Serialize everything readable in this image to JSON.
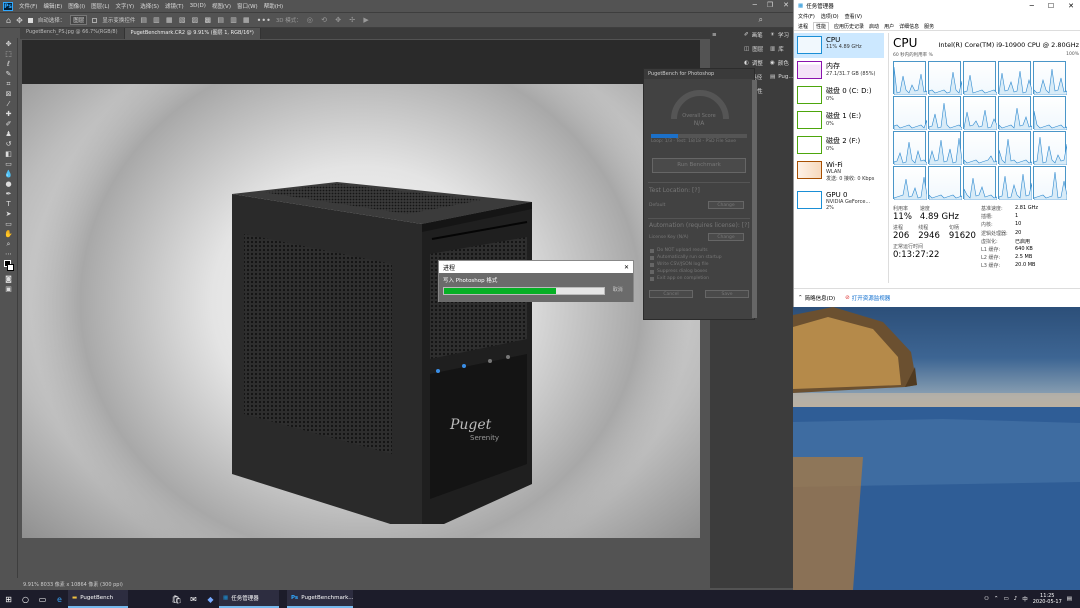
{
  "ps": {
    "logo": "Ps",
    "menu": [
      "文件(F)",
      "编辑(E)",
      "图像(I)",
      "图层(L)",
      "文字(Y)",
      "选择(S)",
      "滤镜(T)",
      "3D(D)",
      "视图(V)",
      "窗口(W)",
      "帮助(H)"
    ],
    "options": {
      "auto_select": "自动选择：",
      "layer_dropdown": "图层",
      "show_transform": "显示变换控件",
      "mode_label": "3D 模式："
    },
    "tabs": [
      "PugetBench_PS.jpg @ 66.7%(RGB/8)",
      "PugetBenchmark.CR2 @ 9.91% (图层 1, RGB/16*)"
    ],
    "status": "9.91%   8033 像素 x 10864 像素 (300 ppi)",
    "right_panels": [
      "画笔",
      "图层",
      "调整",
      "路径",
      "属性",
      "学习",
      "库",
      "颜色"
    ],
    "right_top": [
      "Pug..."
    ]
  },
  "puget": {
    "header": "PugetBench for Photoshop",
    "overall_label": "Overall Score",
    "overall_value": "N/A",
    "progress_text": "Loop: 1/3 · Test: 18/18 - PSD File Save",
    "run_button": "Run Benchmark",
    "test_location_title": "Test Location: [?]",
    "test_location_value": "Default",
    "change_label": "Change",
    "automation_title": "Automation (requires license): [?]",
    "license_key": "License Key (N/A)",
    "checkboxes": [
      "Do NOT upload results",
      "Automatically run on startup",
      "Write CSV/JSON log file",
      "Suppress dialog boxes",
      "Exit app on completion"
    ],
    "cancel": "Cancel",
    "save": "Save"
  },
  "dialog": {
    "title": "进程",
    "message": "写入 Photoshop 格式",
    "cancel": "取消",
    "progress": 0.7
  },
  "tm": {
    "title": "任务管理器",
    "menus": [
      "文件(F)",
      "选项(O)",
      "查看(V)"
    ],
    "tabs": [
      "进程",
      "性能",
      "应用历史记录",
      "启动",
      "用户",
      "详细信息",
      "服务"
    ],
    "resources": [
      {
        "name": "CPU",
        "val": "11% 4.89 GHz",
        "color": "#1a8fd6"
      },
      {
        "name": "内存",
        "val": "27.1/31.7 GB (85%)",
        "color": "#8b12ae"
      },
      {
        "name": "磁盘 0 (C: D:)",
        "val": "0%",
        "color": "#4da60c"
      },
      {
        "name": "磁盘 1 (E:)",
        "val": "0%",
        "color": "#4da60c"
      },
      {
        "name": "磁盘 2 (F:)",
        "val": "0%",
        "color": "#4da60c"
      },
      {
        "name": "Wi-Fi",
        "val": "WLAN",
        "val2": "发送: 0 接收: 0 Kbps",
        "color": "#a74f01"
      },
      {
        "name": "GPU 0",
        "val": "NVIDIA GeForce...",
        "val2": "2%",
        "color": "#1a8fd6"
      }
    ],
    "cpu_title": "CPU",
    "cpu_model": "Intel(R) Core(TM) i9-10900 CPU @ 2.80GHz",
    "chart_left": "60 秒内的利用率 %",
    "chart_right": "100%",
    "util_lbl": "利用率",
    "util_val": "11%",
    "speed_lbl": "速度",
    "speed_val": "4.89 GHz",
    "proc_lbl": "进程",
    "proc_val": "206",
    "thread_lbl": "线程",
    "thread_val": "2946",
    "handle_lbl": "句柄",
    "handle_val": "91620",
    "uptime_lbl": "正常运行时间",
    "uptime_val": "0:13:27:22",
    "specs": [
      [
        "基准速度:",
        "2.81 GHz"
      ],
      [
        "插槽:",
        "1"
      ],
      [
        "内核:",
        "10"
      ],
      [
        "逻辑处理器:",
        "20"
      ],
      [
        "虚拟化:",
        "已启用"
      ],
      [
        "L1 缓存:",
        "640 KB"
      ],
      [
        "L2 缓存:",
        "2.5 MB"
      ],
      [
        "L3 缓存:",
        "20.0 MB"
      ]
    ],
    "footer_brief": "简略信息(D)",
    "footer_monitor": "打开资源监视器"
  },
  "taskbar": {
    "apps": [
      "PugetBench",
      "任务管理器",
      "PugetBenchmark..."
    ],
    "time": "11:25",
    "date": "2020-05-17"
  }
}
